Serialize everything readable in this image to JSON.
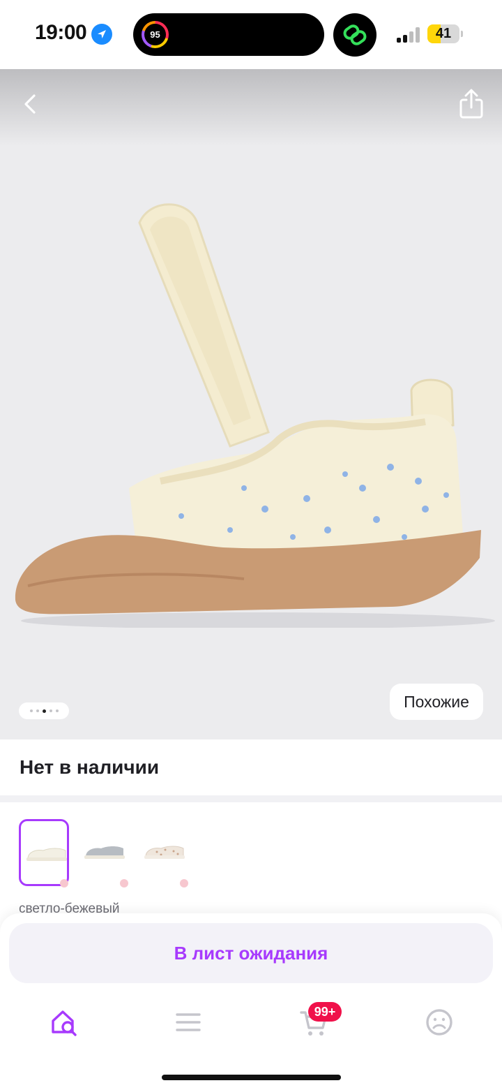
{
  "status_bar": {
    "time": "19:00",
    "activity_value": "95",
    "battery_level": "41",
    "battery_fraction": 0.41,
    "icons": [
      "location-arrow-icon",
      "activity-ring-icon",
      "link-app-icon",
      "signal-icon",
      "battery-icon"
    ]
  },
  "gallery": {
    "image_count": 5,
    "active_index": 2,
    "similar_label": "Похожие",
    "icons": [
      "back-chevron-icon",
      "share-icon"
    ]
  },
  "stock": {
    "status": "Нет в наличии"
  },
  "variants": {
    "selected_color": "светло-бежевый",
    "selected_index": 0,
    "items": [
      {
        "color_hint": "#f3f0e4"
      },
      {
        "color_hint": "#b7bcc2"
      },
      {
        "color_hint": "#efe6dc"
      }
    ]
  },
  "actions": {
    "waitlist_label": "В лист ожидания"
  },
  "tab_bar": {
    "cart_badge": "99+",
    "items": [
      "home-search-icon",
      "menu-icon",
      "cart-icon",
      "profile-icon"
    ]
  },
  "colors": {
    "accent": "#a73afd",
    "badge": "#f0114a",
    "gallery_bg": "#ececee"
  }
}
